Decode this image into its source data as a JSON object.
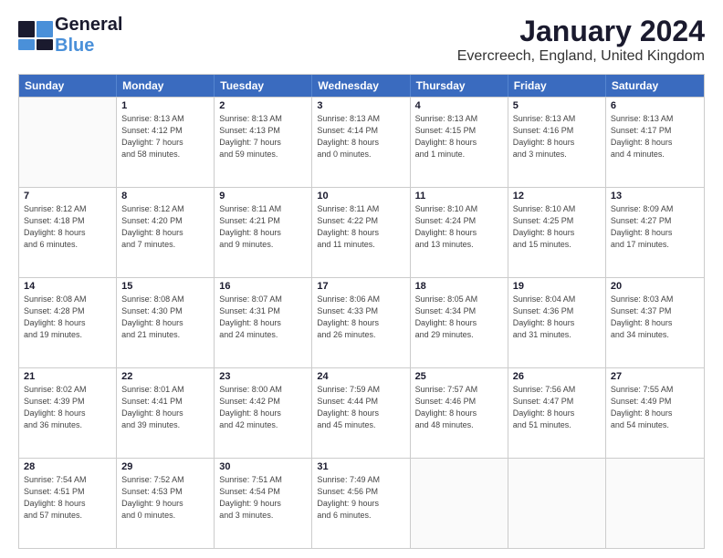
{
  "header": {
    "logo_general": "General",
    "logo_blue": "Blue",
    "title": "January 2024",
    "subtitle": "Evercreech, England, United Kingdom"
  },
  "calendar": {
    "weekdays": [
      "Sunday",
      "Monday",
      "Tuesday",
      "Wednesday",
      "Thursday",
      "Friday",
      "Saturday"
    ],
    "rows": [
      [
        {
          "day": "",
          "info": ""
        },
        {
          "day": "1",
          "info": "Sunrise: 8:13 AM\nSunset: 4:12 PM\nDaylight: 7 hours\nand 58 minutes."
        },
        {
          "day": "2",
          "info": "Sunrise: 8:13 AM\nSunset: 4:13 PM\nDaylight: 7 hours\nand 59 minutes."
        },
        {
          "day": "3",
          "info": "Sunrise: 8:13 AM\nSunset: 4:14 PM\nDaylight: 8 hours\nand 0 minutes."
        },
        {
          "day": "4",
          "info": "Sunrise: 8:13 AM\nSunset: 4:15 PM\nDaylight: 8 hours\nand 1 minute."
        },
        {
          "day": "5",
          "info": "Sunrise: 8:13 AM\nSunset: 4:16 PM\nDaylight: 8 hours\nand 3 minutes."
        },
        {
          "day": "6",
          "info": "Sunrise: 8:13 AM\nSunset: 4:17 PM\nDaylight: 8 hours\nand 4 minutes."
        }
      ],
      [
        {
          "day": "7",
          "info": "Sunrise: 8:12 AM\nSunset: 4:18 PM\nDaylight: 8 hours\nand 6 minutes."
        },
        {
          "day": "8",
          "info": "Sunrise: 8:12 AM\nSunset: 4:20 PM\nDaylight: 8 hours\nand 7 minutes."
        },
        {
          "day": "9",
          "info": "Sunrise: 8:11 AM\nSunset: 4:21 PM\nDaylight: 8 hours\nand 9 minutes."
        },
        {
          "day": "10",
          "info": "Sunrise: 8:11 AM\nSunset: 4:22 PM\nDaylight: 8 hours\nand 11 minutes."
        },
        {
          "day": "11",
          "info": "Sunrise: 8:10 AM\nSunset: 4:24 PM\nDaylight: 8 hours\nand 13 minutes."
        },
        {
          "day": "12",
          "info": "Sunrise: 8:10 AM\nSunset: 4:25 PM\nDaylight: 8 hours\nand 15 minutes."
        },
        {
          "day": "13",
          "info": "Sunrise: 8:09 AM\nSunset: 4:27 PM\nDaylight: 8 hours\nand 17 minutes."
        }
      ],
      [
        {
          "day": "14",
          "info": "Sunrise: 8:08 AM\nSunset: 4:28 PM\nDaylight: 8 hours\nand 19 minutes."
        },
        {
          "day": "15",
          "info": "Sunrise: 8:08 AM\nSunset: 4:30 PM\nDaylight: 8 hours\nand 21 minutes."
        },
        {
          "day": "16",
          "info": "Sunrise: 8:07 AM\nSunset: 4:31 PM\nDaylight: 8 hours\nand 24 minutes."
        },
        {
          "day": "17",
          "info": "Sunrise: 8:06 AM\nSunset: 4:33 PM\nDaylight: 8 hours\nand 26 minutes."
        },
        {
          "day": "18",
          "info": "Sunrise: 8:05 AM\nSunset: 4:34 PM\nDaylight: 8 hours\nand 29 minutes."
        },
        {
          "day": "19",
          "info": "Sunrise: 8:04 AM\nSunset: 4:36 PM\nDaylight: 8 hours\nand 31 minutes."
        },
        {
          "day": "20",
          "info": "Sunrise: 8:03 AM\nSunset: 4:37 PM\nDaylight: 8 hours\nand 34 minutes."
        }
      ],
      [
        {
          "day": "21",
          "info": "Sunrise: 8:02 AM\nSunset: 4:39 PM\nDaylight: 8 hours\nand 36 minutes."
        },
        {
          "day": "22",
          "info": "Sunrise: 8:01 AM\nSunset: 4:41 PM\nDaylight: 8 hours\nand 39 minutes."
        },
        {
          "day": "23",
          "info": "Sunrise: 8:00 AM\nSunset: 4:42 PM\nDaylight: 8 hours\nand 42 minutes."
        },
        {
          "day": "24",
          "info": "Sunrise: 7:59 AM\nSunset: 4:44 PM\nDaylight: 8 hours\nand 45 minutes."
        },
        {
          "day": "25",
          "info": "Sunrise: 7:57 AM\nSunset: 4:46 PM\nDaylight: 8 hours\nand 48 minutes."
        },
        {
          "day": "26",
          "info": "Sunrise: 7:56 AM\nSunset: 4:47 PM\nDaylight: 8 hours\nand 51 minutes."
        },
        {
          "day": "27",
          "info": "Sunrise: 7:55 AM\nSunset: 4:49 PM\nDaylight: 8 hours\nand 54 minutes."
        }
      ],
      [
        {
          "day": "28",
          "info": "Sunrise: 7:54 AM\nSunset: 4:51 PM\nDaylight: 8 hours\nand 57 minutes."
        },
        {
          "day": "29",
          "info": "Sunrise: 7:52 AM\nSunset: 4:53 PM\nDaylight: 9 hours\nand 0 minutes."
        },
        {
          "day": "30",
          "info": "Sunrise: 7:51 AM\nSunset: 4:54 PM\nDaylight: 9 hours\nand 3 minutes."
        },
        {
          "day": "31",
          "info": "Sunrise: 7:49 AM\nSunset: 4:56 PM\nDaylight: 9 hours\nand 6 minutes."
        },
        {
          "day": "",
          "info": ""
        },
        {
          "day": "",
          "info": ""
        },
        {
          "day": "",
          "info": ""
        }
      ]
    ]
  }
}
